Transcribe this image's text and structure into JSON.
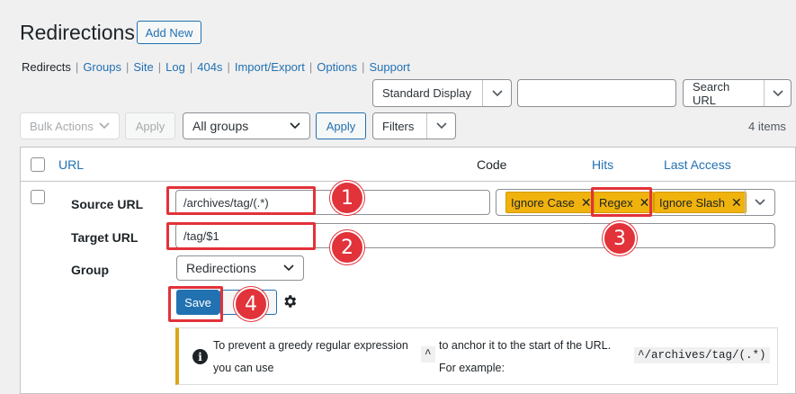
{
  "header": {
    "title": "Redirections",
    "add_new_label": "Add New"
  },
  "subnav": {
    "items": [
      {
        "label": "Redirects",
        "current": true
      },
      {
        "label": "Groups"
      },
      {
        "label": "Site"
      },
      {
        "label": "Log"
      },
      {
        "label": "404s"
      },
      {
        "label": "Import/Export"
      },
      {
        "label": "Options"
      },
      {
        "label": "Support"
      }
    ],
    "separator": "|"
  },
  "toolbar": {
    "display_select": "Standard Display",
    "search_value": "",
    "search_button": "Search URL",
    "bulk_actions": "Bulk Actions",
    "apply_disabled": "Apply",
    "group_select": "All groups",
    "apply": "Apply",
    "filters": "Filters",
    "items_count": "4 items"
  },
  "table": {
    "columns": [
      "URL",
      "Code",
      "Hits",
      "Last Access"
    ]
  },
  "edit_form": {
    "source_label": "Source URL",
    "source_value": "/archives/tag/(.*)",
    "target_label": "Target URL",
    "target_value": "/tag/$1",
    "group_label": "Group",
    "group_value": "Redirections",
    "flags": [
      "Ignore Case",
      "Regex",
      "Ignore Slash"
    ],
    "flag_remove": "✕",
    "save_label": "Save"
  },
  "notice": {
    "icon": "info-icon",
    "text1a": "To prevent a greedy regular expression",
    "text1b": "you can use",
    "caret": "^",
    "text2a": "to anchor it to the start of the URL.",
    "text2b": "For example:",
    "example": "^/archives/tag/(.*)"
  },
  "annotations": [
    "1",
    "2",
    "3",
    "4"
  ],
  "colors": {
    "accent": "#2271b1",
    "tag": "#f0b20d",
    "annotation": "#e2323a",
    "notice_border": "#dba617"
  }
}
